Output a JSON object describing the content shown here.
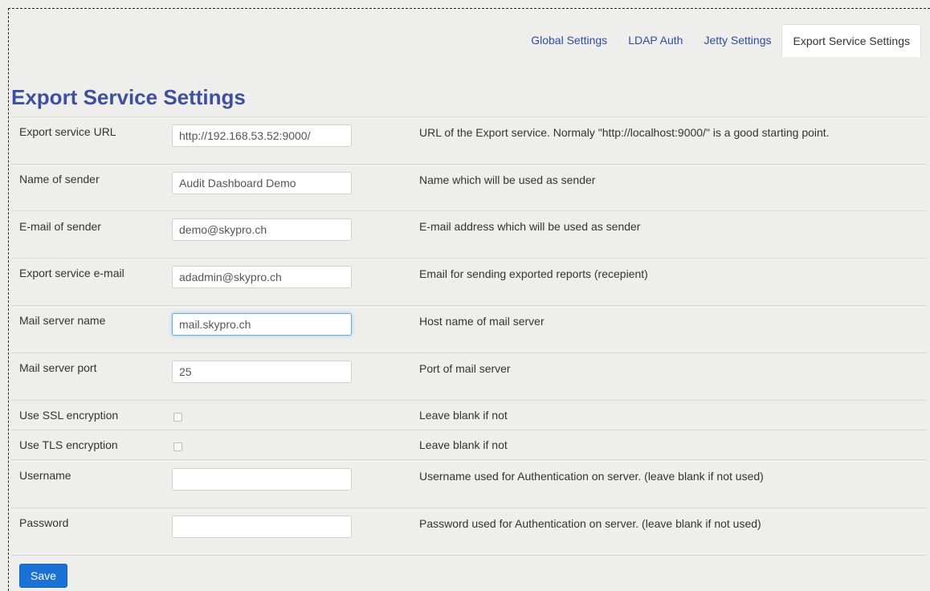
{
  "tabs": [
    {
      "label": "Global Settings"
    },
    {
      "label": "LDAP Auth"
    },
    {
      "label": "Jetty Settings"
    },
    {
      "label": "Export Service Settings"
    }
  ],
  "page_title": "Export Service Settings",
  "fields": [
    {
      "label": "Export service URL",
      "value": "http://192.168.53.52:9000/",
      "description": "URL of the Export service. Normaly \"http://localhost:9000/\" is a good starting point."
    },
    {
      "label": "Name of sender",
      "value": "Audit Dashboard Demo",
      "description": "Name which will be used as sender"
    },
    {
      "label": "E-mail of sender",
      "value": "demo@skypro.ch",
      "description": "E-mail address which will be used as sender"
    },
    {
      "label": "Export service e-mail",
      "value": "adadmin@skypro.ch",
      "description": "Email for sending exported reports (recepient)"
    },
    {
      "label": "Mail server name",
      "value": "mail.skypro.ch",
      "description": "Host name of mail server"
    },
    {
      "label": "Mail server port",
      "value": "25",
      "description": "Port of mail server"
    },
    {
      "label": "Use SSL encryption",
      "description": "Leave blank if not"
    },
    {
      "label": "Use TLS encryption",
      "description": "Leave blank if not"
    },
    {
      "label": "Username",
      "value": "",
      "description": "Username used for Authentication on server. (leave blank if not used)"
    },
    {
      "label": "Password",
      "value": "",
      "description": "Password used for Authentication on server. (leave blank if not used)"
    }
  ],
  "save_label": "Save"
}
